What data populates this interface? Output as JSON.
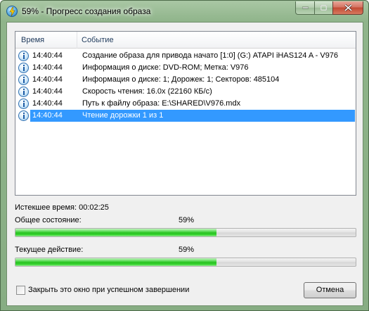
{
  "window": {
    "title": "59% - Прогресс создания образа"
  },
  "log": {
    "columns": {
      "time": "Время",
      "event": "Событие"
    },
    "rows": [
      {
        "time": "14:40:44",
        "event": "Создание образа для привода начато [1:0] (G:) ATAPI iHAS124   A - V976",
        "icon": "info-icon"
      },
      {
        "time": "14:40:44",
        "event": "Информация о диске: DVD-ROM; Метка: V976",
        "icon": "info-icon"
      },
      {
        "time": "14:40:44",
        "event": "Информация о диске: 1; Дорожек: 1; Секторов: 485104",
        "icon": "info-icon"
      },
      {
        "time": "14:40:44",
        "event": "Скорость чтения: 16.0x (22160 КБ/с)",
        "icon": "info-icon"
      },
      {
        "time": "14:40:44",
        "event": "Путь к файлу образа: E:\\SHARED\\V976.mdx",
        "icon": "info-icon"
      },
      {
        "time": "14:40:44",
        "event": "Чтение дорожки 1 из 1",
        "icon": "info-icon",
        "selected": true
      }
    ]
  },
  "elapsed": {
    "text": "Истекшее время: 00:02:25"
  },
  "overall": {
    "label": "Общее состояние:",
    "percent_text": "59%",
    "value": 0.59
  },
  "current": {
    "label": "Текущее действие:",
    "percent_text": "59%",
    "value": 0.59
  },
  "options": {
    "close_on_success_label": "Закрыть это окно при успешном завершении",
    "close_on_success_checked": false
  },
  "buttons": {
    "cancel": "Отмена"
  },
  "colors": {
    "selection": "#3399ff",
    "progress": "#27c21f"
  }
}
